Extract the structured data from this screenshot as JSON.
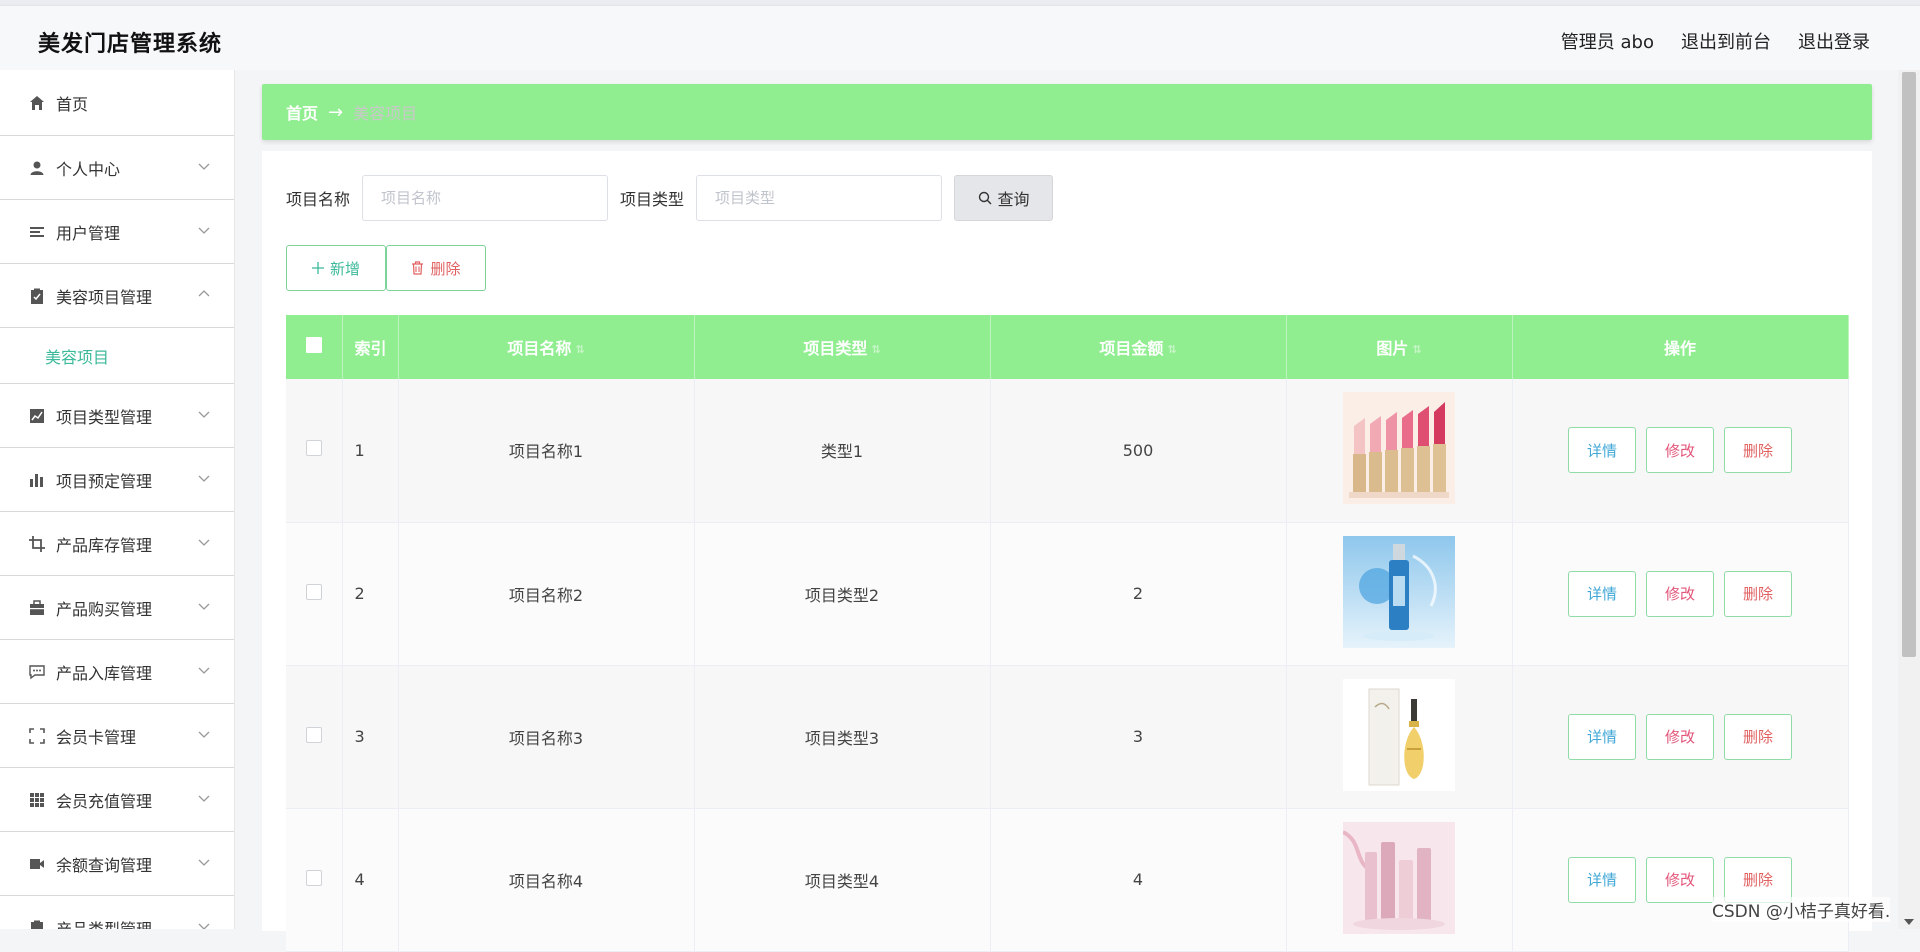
{
  "header": {
    "title": "美发门店管理系统",
    "admin": "管理员 abo",
    "to_front": "退出到前台",
    "logout": "退出登录"
  },
  "sidebar": {
    "items": [
      {
        "label": "首页",
        "icon": "home-icon"
      },
      {
        "label": "个人中心",
        "icon": "user-icon"
      },
      {
        "label": "用户管理",
        "icon": "list-icon"
      },
      {
        "label": "美容项目管理",
        "icon": "clipboard-icon"
      },
      {
        "label": "项目类型管理",
        "icon": "chart-icon"
      },
      {
        "label": "项目预定管理",
        "icon": "bar-chart-icon"
      },
      {
        "label": "产品库存管理",
        "icon": "crop-icon"
      },
      {
        "label": "产品购买管理",
        "icon": "briefcase-icon"
      },
      {
        "label": "产品入库管理",
        "icon": "chat-icon"
      },
      {
        "label": "会员卡管理",
        "icon": "fullscreen-icon"
      },
      {
        "label": "会员充值管理",
        "icon": "grid-icon"
      },
      {
        "label": "余额查询管理",
        "icon": "video-icon"
      },
      {
        "label": "产品类型管理",
        "icon": "clipboard-icon"
      }
    ],
    "active_sub": "美容项目"
  },
  "breadcrumb": {
    "home": "首页",
    "separator": "→",
    "current": "美容项目"
  },
  "search": {
    "name_label": "项目名称",
    "name_placeholder": "项目名称",
    "type_label": "项目类型",
    "type_placeholder": "项目类型",
    "button": "查询"
  },
  "actions": {
    "add": "新增",
    "delete": "删除"
  },
  "table": {
    "headers": [
      "索引",
      "项目名称",
      "项目类型",
      "项目金额",
      "图片",
      "操作"
    ],
    "rows": [
      {
        "index": "1",
        "name": "项目名称1",
        "type": "类型1",
        "amount": "500",
        "image": "lipstick-image"
      },
      {
        "index": "2",
        "name": "项目名称2",
        "type": "项目类型2",
        "amount": "2",
        "image": "blue-bottle-image"
      },
      {
        "index": "3",
        "name": "项目名称3",
        "type": "项目类型3",
        "amount": "3",
        "image": "perfume-image"
      },
      {
        "index": "4",
        "name": "项目名称4",
        "type": "项目类型4",
        "amount": "4",
        "image": "pink-bottles-image"
      }
    ],
    "op_detail": "详情",
    "op_edit": "修改",
    "op_delete": "删除"
  },
  "colors": {
    "accent_green": "#90ee90",
    "teal": "#3bb99a",
    "red": "#e06060"
  },
  "watermark": "CSDN @小桔子真好看."
}
